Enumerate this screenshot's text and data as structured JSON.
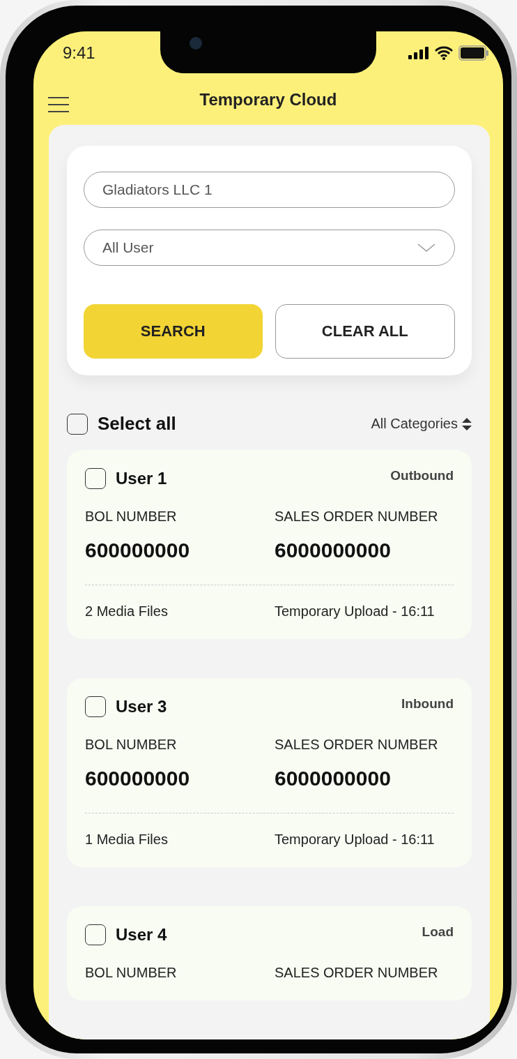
{
  "status_bar": {
    "time": "9:41"
  },
  "header": {
    "title": "Temporary Cloud"
  },
  "filters": {
    "company": {
      "value": "Gladiators LLC 1"
    },
    "user_select": {
      "value": "All User"
    },
    "buttons": [
      {
        "label": "SEARCH",
        "kind": "primary"
      },
      {
        "label": "CLEAR ALL",
        "kind": "secondary"
      }
    ]
  },
  "list_header": {
    "select_all": {
      "label": "Select all",
      "checked": false
    },
    "sort": {
      "label": "All Categories"
    }
  },
  "records": [
    {
      "user": "User 1",
      "checked": false,
      "category": "Outbound",
      "bol_label": "BOL NUMBER",
      "bol_value": "600000000",
      "so_label": "SALES ORDER NUMBER",
      "so_value": "6000000000",
      "media": "2 Media Files",
      "upload": "Temporary Upload - 16:11"
    },
    {
      "user": "User 3",
      "checked": false,
      "category": "Inbound",
      "bol_label": "BOL NUMBER",
      "bol_value": "600000000",
      "so_label": "SALES ORDER NUMBER",
      "so_value": "6000000000",
      "media": "1 Media Files",
      "upload": "Temporary Upload - 16:11"
    },
    {
      "user": "User 4",
      "checked": false,
      "category": "Load",
      "bol_label": "BOL NUMBER",
      "so_label": "SALES ORDER NUMBER"
    }
  ]
}
